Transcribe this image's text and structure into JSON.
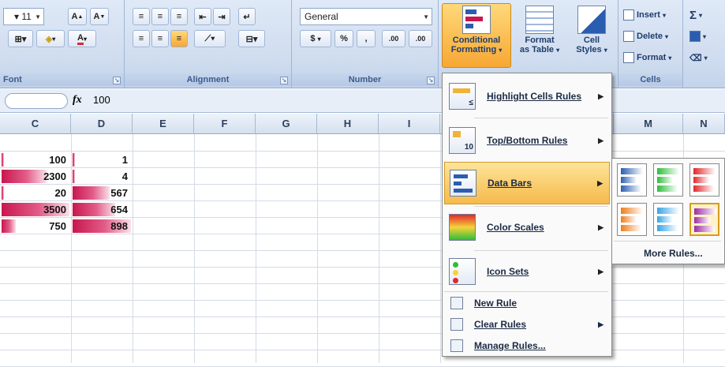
{
  "ribbon": {
    "font": {
      "size": "11",
      "group_label": "Font"
    },
    "alignment": {
      "group_label": "Alignment"
    },
    "number": {
      "format": "General",
      "currency": "$",
      "percent": "%",
      "comma": ",",
      "inc": ".00",
      "dec": ".00",
      "group_label": "Number"
    },
    "styles": {
      "conditional_formatting": "Conditional",
      "conditional_formatting_2": "Formatting",
      "format_as_table": "Format",
      "format_as_table_2": "as Table",
      "cell_styles": "Cell",
      "cell_styles_2": "Styles"
    },
    "cells": {
      "insert": "Insert",
      "delete": "Delete",
      "format": "Format",
      "group_label": "Cells"
    },
    "editing": {
      "sigma": "Σ"
    }
  },
  "formula_bar": {
    "fx": "fx",
    "value": "100"
  },
  "grid": {
    "columns": [
      "C",
      "D",
      "E",
      "F",
      "G",
      "H",
      "I",
      "",
      "",
      "",
      "M",
      "N"
    ],
    "col_c": [
      {
        "text": "100",
        "fraction": 0.03
      },
      {
        "text": "2300",
        "fraction": 0.66
      },
      {
        "text": "20",
        "fraction": 0.01
      },
      {
        "text": "3500",
        "fraction": 1.0
      },
      {
        "text": "750",
        "fraction": 0.21
      }
    ],
    "col_d": [
      {
        "text": "1",
        "fraction": 0.0
      },
      {
        "text": "4",
        "fraction": 0.0
      },
      {
        "text": "567",
        "fraction": 0.63
      },
      {
        "text": "654",
        "fraction": 0.73
      },
      {
        "text": "898",
        "fraction": 1.0
      }
    ]
  },
  "menu": {
    "items": [
      {
        "label": "Highlight Cells Rules",
        "has_submenu": true
      },
      {
        "label": "Top/Bottom Rules",
        "has_submenu": true
      },
      {
        "label": "Data Bars",
        "has_submenu": true
      },
      {
        "label": "Color Scales",
        "has_submenu": true
      },
      {
        "label": "Icon Sets",
        "has_submenu": true
      }
    ],
    "small_items": [
      {
        "label": "New Rule",
        "has_submenu": false
      },
      {
        "label": "Clear Rules",
        "has_submenu": true
      },
      {
        "label": "Manage Rules...",
        "has_submenu": false
      }
    ]
  },
  "data_bars_submenu": {
    "swatches": [
      {
        "name": "blue-data-bar",
        "color": "#2a5db0"
      },
      {
        "name": "green-data-bar",
        "color": "#2ebd3a"
      },
      {
        "name": "red-data-bar",
        "color": "#e0282b"
      },
      {
        "name": "orange-data-bar",
        "color": "#f07c1a"
      },
      {
        "name": "lightblue-data-bar",
        "color": "#36a4e6"
      },
      {
        "name": "purple-data-bar",
        "color": "#9c2ca6"
      }
    ],
    "more_rules": "More Rules..."
  },
  "colors": {
    "accent": "#f6ba4b",
    "bar": "#c8174f"
  }
}
